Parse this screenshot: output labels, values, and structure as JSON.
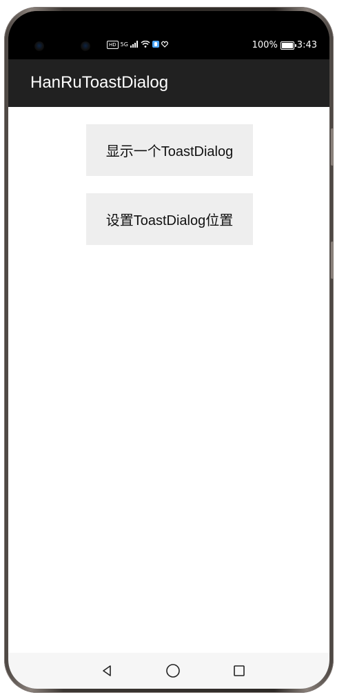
{
  "status_bar": {
    "hd": "HD",
    "network": "5G",
    "battery": "100%",
    "time": "3:43",
    "battery_fill": 1.0,
    "icons": [
      "signal-icon",
      "wifi-icon",
      "shield-icon",
      "heart-icon"
    ]
  },
  "app_bar": {
    "title": "HanRuToastDialog",
    "background": "#212121"
  },
  "main": {
    "buttons": [
      {
        "label": "显示一个ToastDialog"
      },
      {
        "label": "设置ToastDialog位置"
      }
    ]
  },
  "navigation": {
    "items": [
      "back-icon",
      "home-icon",
      "recent-apps-icon"
    ]
  }
}
